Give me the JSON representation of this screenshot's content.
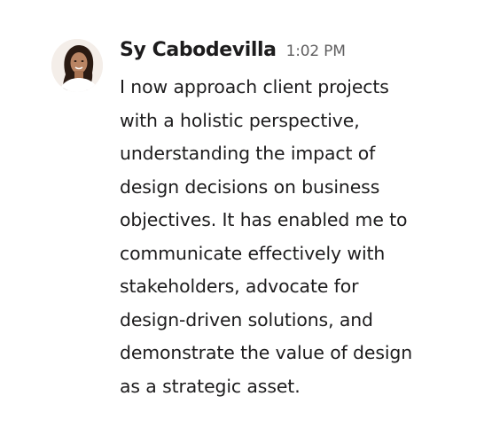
{
  "message": {
    "sender": "Sy Cabodevilla",
    "time": "1:02 PM",
    "body_lines": [
      "I now approach client projects",
      "with a holistic perspective,",
      "understanding the impact of",
      "design decisions on business",
      "objectives. It has enabled me to",
      "communicate effectively with",
      "stakeholders, advocate for",
      "design-driven solutions, and",
      "demonstrate the value of design",
      "as a strategic asset."
    ]
  }
}
